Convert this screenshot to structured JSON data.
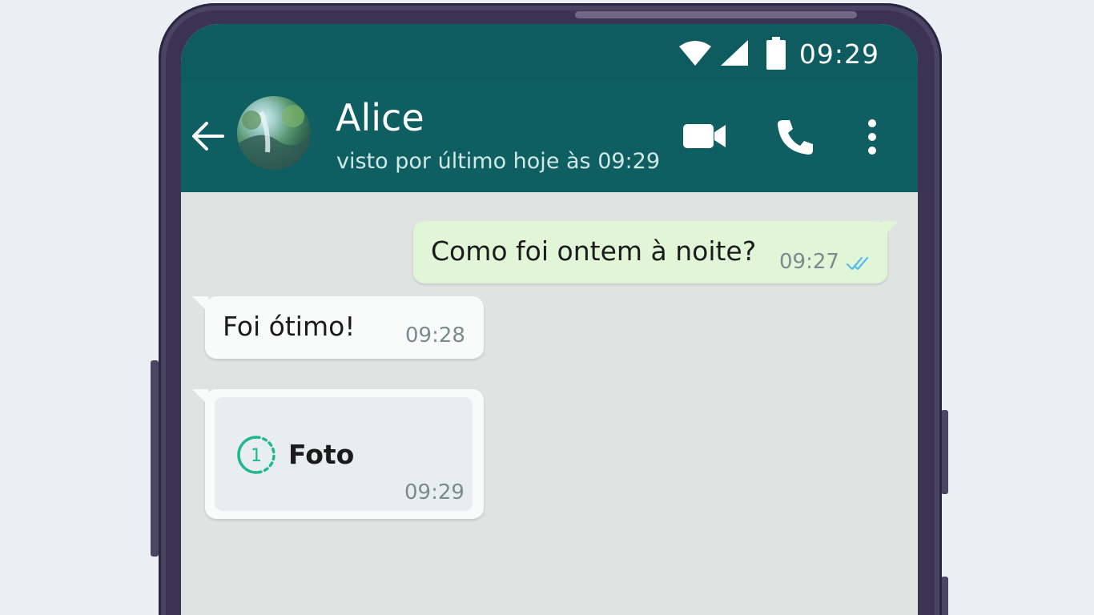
{
  "status_bar": {
    "time": "09:29"
  },
  "header": {
    "contact_name": "Alice",
    "last_seen": "visto por último hoje às 09:29"
  },
  "messages": [
    {
      "direction": "outgoing",
      "text": "Como foi ontem à noite?",
      "time": "09:27",
      "status": "read"
    },
    {
      "direction": "incoming",
      "text": "Foi ótimo!",
      "time": "09:28"
    },
    {
      "direction": "incoming",
      "type": "view-once-photo",
      "view_once_count": "1",
      "text": "Foto",
      "time": "09:29"
    }
  ],
  "colors": {
    "header": "#0f5f62",
    "outgoing_bubble": "#e1f5d7",
    "incoming_bubble": "#f8fbfa",
    "chat_background": "#dfe4e2",
    "read_ticks": "#53bdeb",
    "view_once_accent": "#1fb790"
  },
  "icons": {
    "back": "arrow-left-icon",
    "video": "videocam-icon",
    "call": "phone-icon",
    "menu": "more-vertical-icon",
    "wifi": "wifi-icon",
    "signal": "signal-icon",
    "battery": "battery-icon",
    "read": "double-check-icon",
    "view_once": "view-once-icon"
  }
}
